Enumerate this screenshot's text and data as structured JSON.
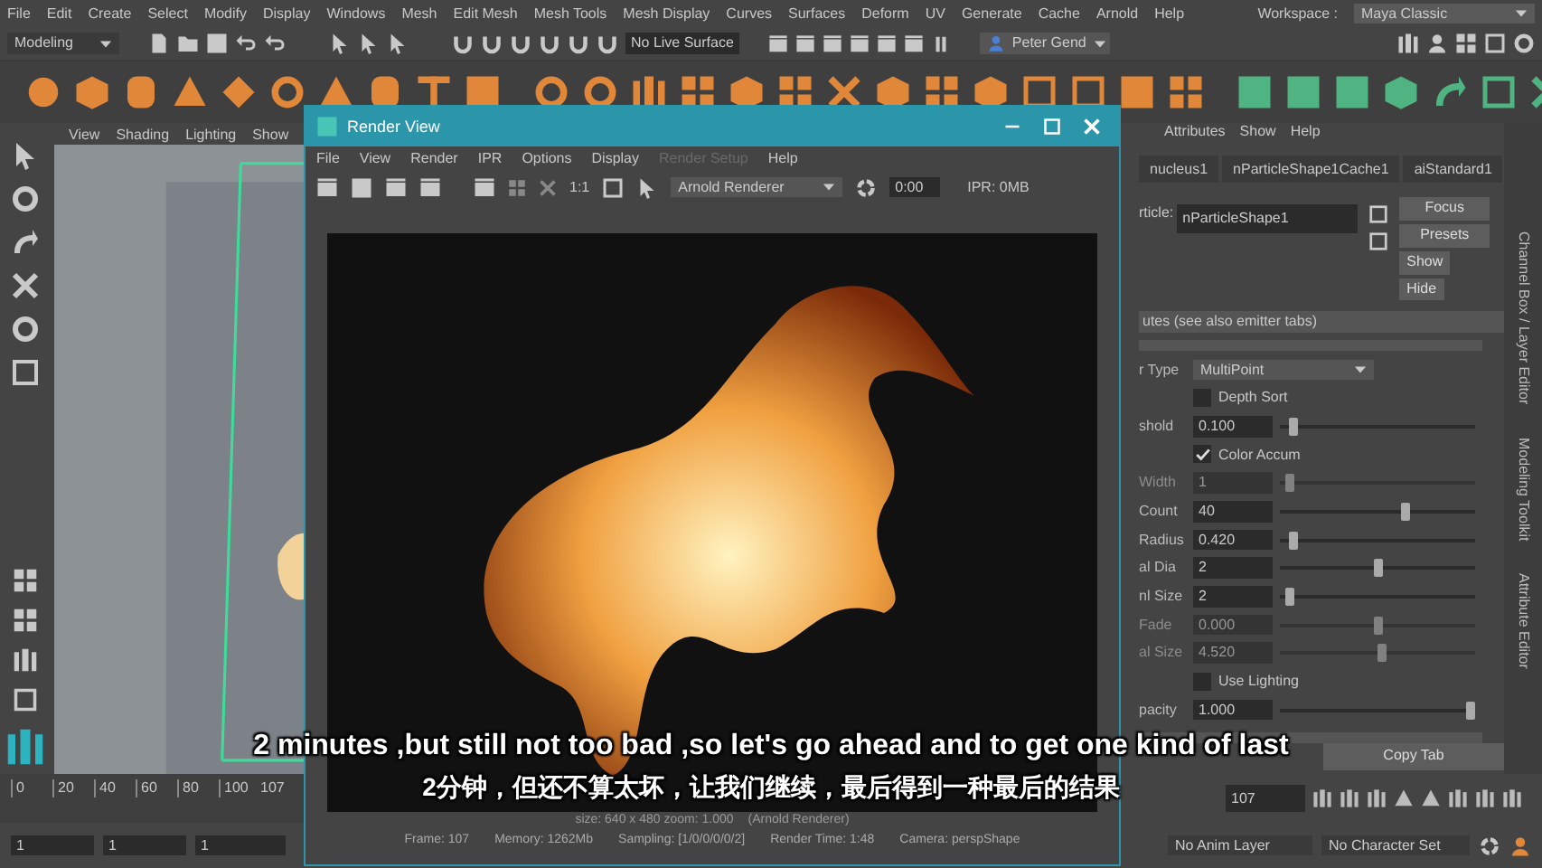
{
  "menu_bar": {
    "items": [
      "File",
      "Edit",
      "Create",
      "Select",
      "Modify",
      "Display",
      "Windows",
      "Mesh",
      "Edit Mesh",
      "Mesh Tools",
      "Mesh Display",
      "Curves",
      "Surfaces",
      "Deform",
      "UV",
      "Generate",
      "Cache",
      "Arnold",
      "Help"
    ],
    "workspace_label": "Workspace :",
    "workspace": "Maya Classic"
  },
  "status_line": {
    "mode": "Modeling",
    "live_surface": "No Live Surface",
    "user": "Peter Gend"
  },
  "viewport": {
    "menus": [
      "View",
      "Shading",
      "Lighting",
      "Show"
    ]
  },
  "render_view": {
    "title": "Render View",
    "menus": [
      {
        "label": "File",
        "disabled": false
      },
      {
        "label": "View",
        "disabled": false
      },
      {
        "label": "Render",
        "disabled": false
      },
      {
        "label": "IPR",
        "disabled": false
      },
      {
        "label": "Options",
        "disabled": false
      },
      {
        "label": "Display",
        "disabled": false
      },
      {
        "label": "Render Setup",
        "disabled": true
      },
      {
        "label": "Help",
        "disabled": false
      }
    ],
    "zoom_label": "1:1",
    "renderer": "Arnold Renderer",
    "time": "0:00",
    "ipr": "IPR: 0MB",
    "image_info": "size: 640 x 480 zoom: 1.000",
    "renderer_info": "(Arnold Renderer)",
    "status": [
      "Frame: 107",
      "Memory: 1262Mb",
      "Sampling: [1/0/0/0/0/2]",
      "Render Time: 1:48",
      "Camera: perspShape"
    ]
  },
  "attribute_editor": {
    "menus": [
      "Attributes",
      "Show",
      "Help"
    ],
    "tabs": [
      {
        "label": "nucleus1",
        "selected": false
      },
      {
        "label": "nParticleShape1Cache1",
        "selected": false
      },
      {
        "label": "aiStandard1",
        "selected": false
      }
    ],
    "node_label": "rticle:",
    "node_name": "nParticleShape1",
    "buttons": [
      "Focus",
      "Presets",
      "Show",
      "Hide"
    ],
    "section": "utes (see also emitter tabs)",
    "rows": [
      {
        "kind": "dropdown",
        "label": "r Type",
        "value": "MultiPoint"
      },
      {
        "kind": "checkbox",
        "label": "Depth Sort",
        "checked": false
      },
      {
        "kind": "slider",
        "label": "shold",
        "value": "0.100",
        "level": 0.05,
        "disabled": false
      },
      {
        "kind": "checkbox",
        "label": "Color Accum",
        "checked": true
      },
      {
        "kind": "slider",
        "label": "Width",
        "value": "1",
        "level": 0.03,
        "disabled": true
      },
      {
        "kind": "slider",
        "label": "Count",
        "value": "40",
        "level": 0.65,
        "disabled": false
      },
      {
        "kind": "slider",
        "label": "Radius",
        "value": "0.420",
        "level": 0.05,
        "disabled": false
      },
      {
        "kind": "slider",
        "label": "al Dia",
        "value": "2",
        "level": 0.5,
        "disabled": false
      },
      {
        "kind": "slider",
        "label": "nl Size",
        "value": "2",
        "level": 0.03,
        "disabled": false
      },
      {
        "kind": "slider",
        "label": "Fade",
        "value": "0.000",
        "level": 0.5,
        "disabled": true
      },
      {
        "kind": "slider",
        "label": "al Size",
        "value": "4.520",
        "level": 0.52,
        "disabled": true
      },
      {
        "kind": "checkbox",
        "label": "Use Lighting",
        "checked": false
      },
      {
        "kind": "slider",
        "label": "pacity",
        "value": "1.000",
        "level": 1.0,
        "disabled": false
      }
    ],
    "copy_tab": "Copy Tab"
  },
  "side_tabs": [
    "Channel Box / Layer Editor",
    "Modeling Toolkit",
    "Attribute Editor"
  ],
  "time_slider": {
    "ticks": [
      "0",
      "20",
      "40",
      "60",
      "80",
      "100"
    ],
    "current_frame": "107",
    "frame_field": "107"
  },
  "range_slider": {
    "start": "1",
    "range_start": "1",
    "range_value": "1",
    "anim_layer": "No Anim Layer",
    "character_set": "No Character Set"
  },
  "subtitles": [
    "2 minutes ,but still not too bad ,so let's go ahead and to get one kind of last",
    "2分钟，但还不算太坏，让我们继续，最后得到一种最后的结果"
  ]
}
